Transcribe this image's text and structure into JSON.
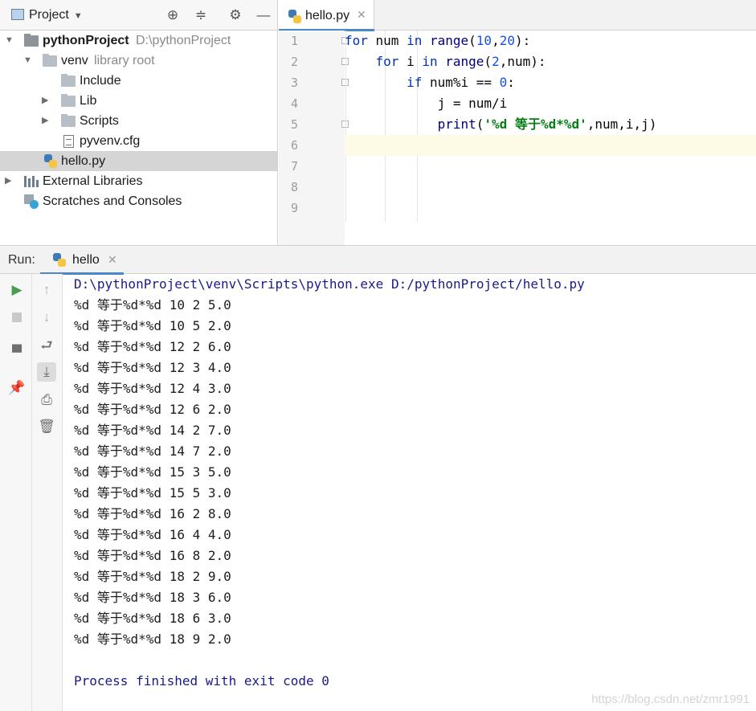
{
  "project_panel": {
    "title": "Project",
    "tree": [
      {
        "label": "pythonProject",
        "hint": "D:\\pythonProject"
      },
      {
        "label": "venv",
        "hint": "library root"
      },
      {
        "label": "Include"
      },
      {
        "label": "Lib"
      },
      {
        "label": "Scripts"
      },
      {
        "label": "pyvenv.cfg"
      },
      {
        "label": "hello.py"
      },
      {
        "label": "External Libraries"
      },
      {
        "label": "Scratches and Consoles"
      }
    ]
  },
  "editor": {
    "tab_label": "hello.py",
    "line_numbers": [
      "1",
      "2",
      "3",
      "4",
      "5",
      "6",
      "7",
      "8",
      "9"
    ],
    "code": {
      "l1": {
        "for": "for",
        "v1": " num ",
        "in": "in",
        "sp": " ",
        "range": "range",
        "p1": "(",
        "n10": "10",
        "c": ",",
        "n20": "20",
        "p2": "):"
      },
      "l2": {
        "indent": "    ",
        "for": "for",
        "v1": " i ",
        "in": "in",
        "sp": " ",
        "range": "range",
        "p1": "(",
        "n2": "2",
        "rest": ",num):"
      },
      "l3": {
        "indent": "        ",
        "if": "if",
        "expr": " num%i == ",
        "n0": "0",
        "colon": ":"
      },
      "l4": {
        "text": "            j = num/i"
      },
      "l5": {
        "indent": "            ",
        "print": "print",
        "p1": "(",
        "str": "'%d 等于%d*%d'",
        "rest": ",num,i,j)"
      }
    }
  },
  "run_panel": {
    "label": "Run:",
    "tab_label": "hello",
    "command": "D:\\pythonProject\\venv\\Scripts\\python.exe D:/pythonProject/hello.py",
    "output": [
      "%d 等于%d*%d 10 2 5.0",
      "%d 等于%d*%d 10 5 2.0",
      "%d 等于%d*%d 12 2 6.0",
      "%d 等于%d*%d 12 3 4.0",
      "%d 等于%d*%d 12 4 3.0",
      "%d 等于%d*%d 12 6 2.0",
      "%d 等于%d*%d 14 2 7.0",
      "%d 等于%d*%d 14 7 2.0",
      "%d 等于%d*%d 15 3 5.0",
      "%d 等于%d*%d 15 5 3.0",
      "%d 等于%d*%d 16 2 8.0",
      "%d 等于%d*%d 16 4 4.0",
      "%d 等于%d*%d 16 8 2.0",
      "%d 等于%d*%d 18 2 9.0",
      "%d 等于%d*%d 18 3 6.0",
      "%d 等于%d*%d 18 6 3.0",
      "%d 等于%d*%d 18 9 2.0"
    ],
    "exit_message": "Process finished with exit code 0",
    "watermark": "https://blog.csdn.net/zmr1991"
  }
}
